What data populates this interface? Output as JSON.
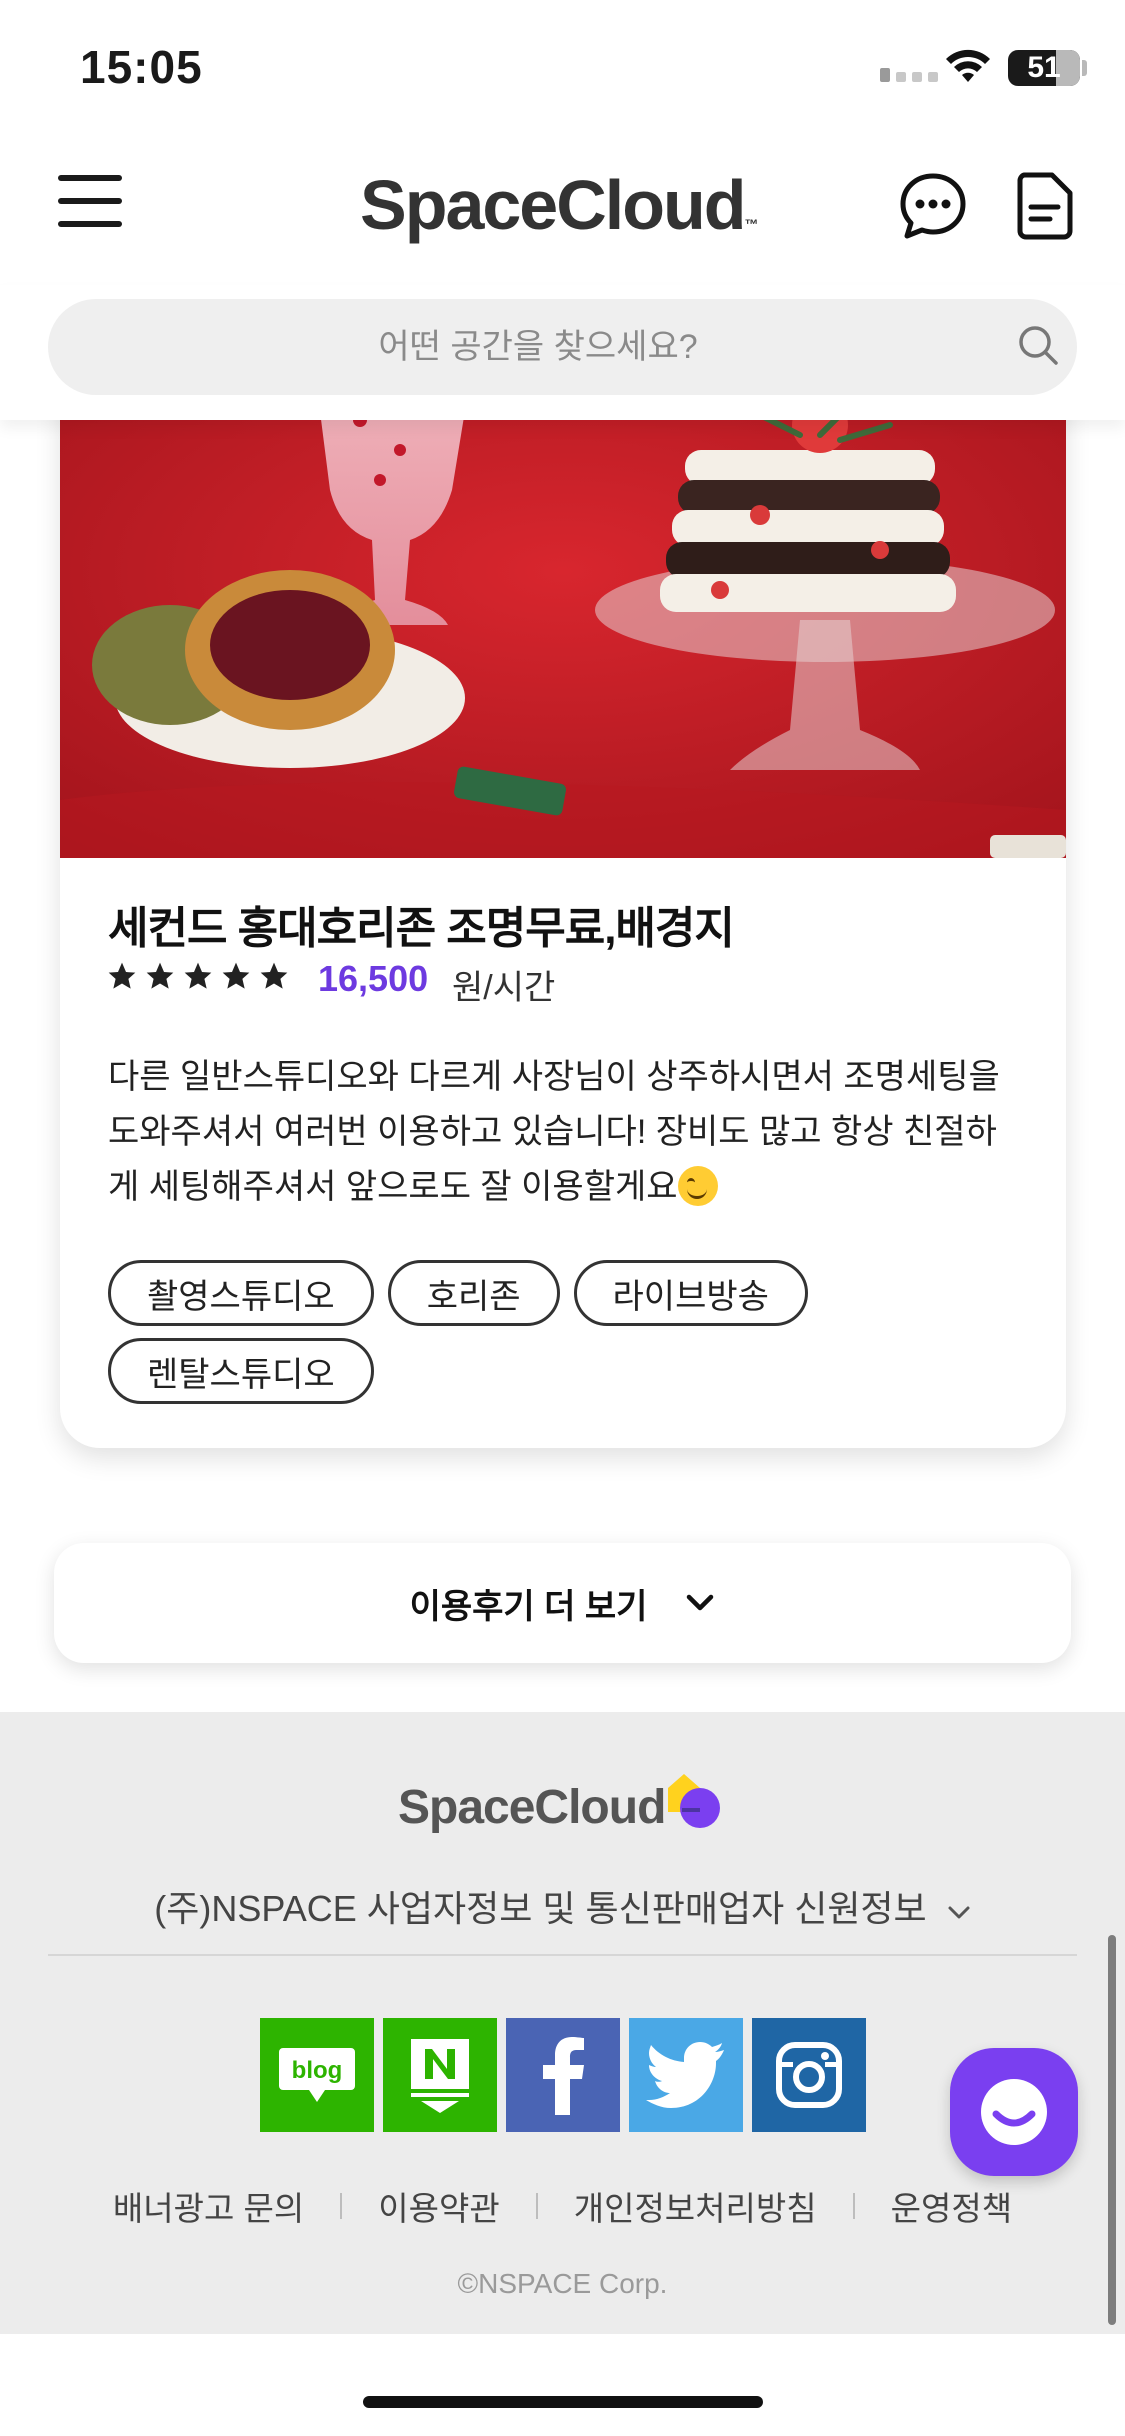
{
  "status_bar": {
    "time": "15:05",
    "battery": "51"
  },
  "header": {
    "logo": "SpaceCloud"
  },
  "search": {
    "placeholder": "어떤 공간을 찾으세요?"
  },
  "review": {
    "title": "세컨드 홍대호리존 조명무료,배경지",
    "rating_stars": 5,
    "price": "16,500",
    "price_unit": "원/시간",
    "text": "다른 일반스튜디오와 다르게 사장님이 상주하시면서 조명세팅을 도와주셔서 여러번 이용하고 있습니다! 장비도 많고 항상 친절하게 세팅해주셔서 앞으로도 잘 이용할게요",
    "tags": [
      "촬영스튜디오",
      "호리존",
      "라이브방송",
      "렌탈스튜디오"
    ]
  },
  "more_reviews": {
    "label": "이용후기 더 보기"
  },
  "footer": {
    "logo": "SpaceCloud",
    "company_info": "(주)NSPACE 사업자정보 및 통신판매업자 신원정보",
    "social": [
      "blog",
      "naver-post",
      "facebook",
      "twitter",
      "instagram"
    ],
    "social_colors": {
      "blog": "#2db400",
      "naver-post": "#2db400",
      "facebook": "#4a64b4",
      "twitter": "#4aa8e6",
      "instagram": "#1f66a5"
    },
    "links": [
      "배너광고 문의",
      "이용약관",
      "개인정보처리방침",
      "운영정책"
    ],
    "copyright": "©NSPACE Corp."
  },
  "colors": {
    "accent": "#6d3ae0",
    "fab": "#7a3ff0"
  }
}
